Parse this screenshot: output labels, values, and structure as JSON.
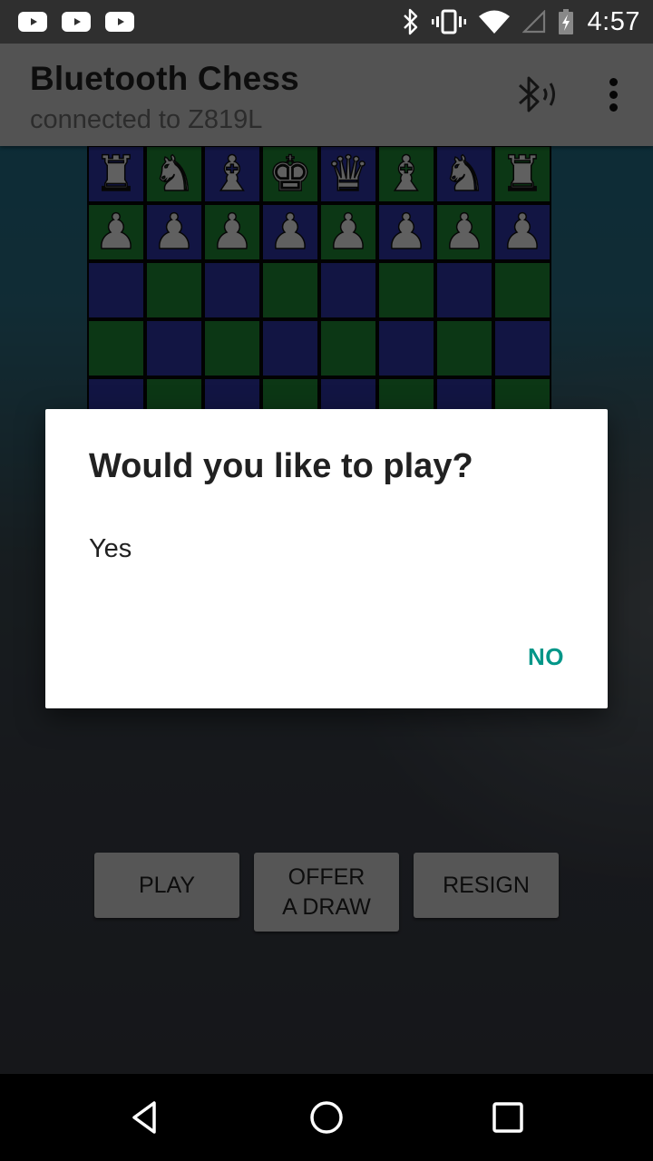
{
  "status_bar": {
    "notification_icons": [
      "youtube-icon",
      "youtube-icon",
      "youtube-icon"
    ],
    "system_icons": [
      "bluetooth-icon",
      "vibrate-icon",
      "wifi-icon",
      "cell-signal-icon",
      "battery-charging-icon"
    ],
    "time": "4:57"
  },
  "app_bar": {
    "title": "Bluetooth Chess",
    "subtitle": "connected to Z819L",
    "actions": [
      "bluetooth-discoverable-icon",
      "overflow-menu-icon"
    ]
  },
  "board": {
    "colors": {
      "dark": "#2e36a8",
      "light": "#1f8a35"
    },
    "rows": [
      [
        "♜",
        "♞",
        "♝",
        "♚",
        "♛",
        "♝",
        "♞",
        "♜"
      ],
      [
        "♟",
        "♟",
        "♟",
        "♟",
        "♟",
        "♟",
        "♟",
        "♟"
      ],
      [
        "",
        "",
        "",
        "",
        "",
        "",
        "",
        ""
      ],
      [
        "",
        "",
        "",
        "",
        "",
        "",
        "",
        ""
      ],
      [
        "",
        "",
        "",
        "",
        "",
        "",
        "",
        ""
      ],
      [
        "",
        "",
        "",
        "",
        "",
        "",
        "",
        ""
      ],
      [
        "",
        "",
        "",
        "",
        "",
        "",
        "",
        ""
      ],
      [
        "",
        "",
        "",
        "",
        "",
        "",
        "",
        ""
      ]
    ]
  },
  "game_buttons": {
    "play": "PLAY",
    "offer_draw": "OFFER\nA DRAW",
    "resign": "RESIGN"
  },
  "dialog": {
    "title": "Would you like to play?",
    "items": [
      "Yes"
    ],
    "negative_button": "NO",
    "accent_color": "#009688"
  },
  "nav_bar": {
    "buttons": [
      "back-icon",
      "home-icon",
      "recents-icon"
    ]
  }
}
